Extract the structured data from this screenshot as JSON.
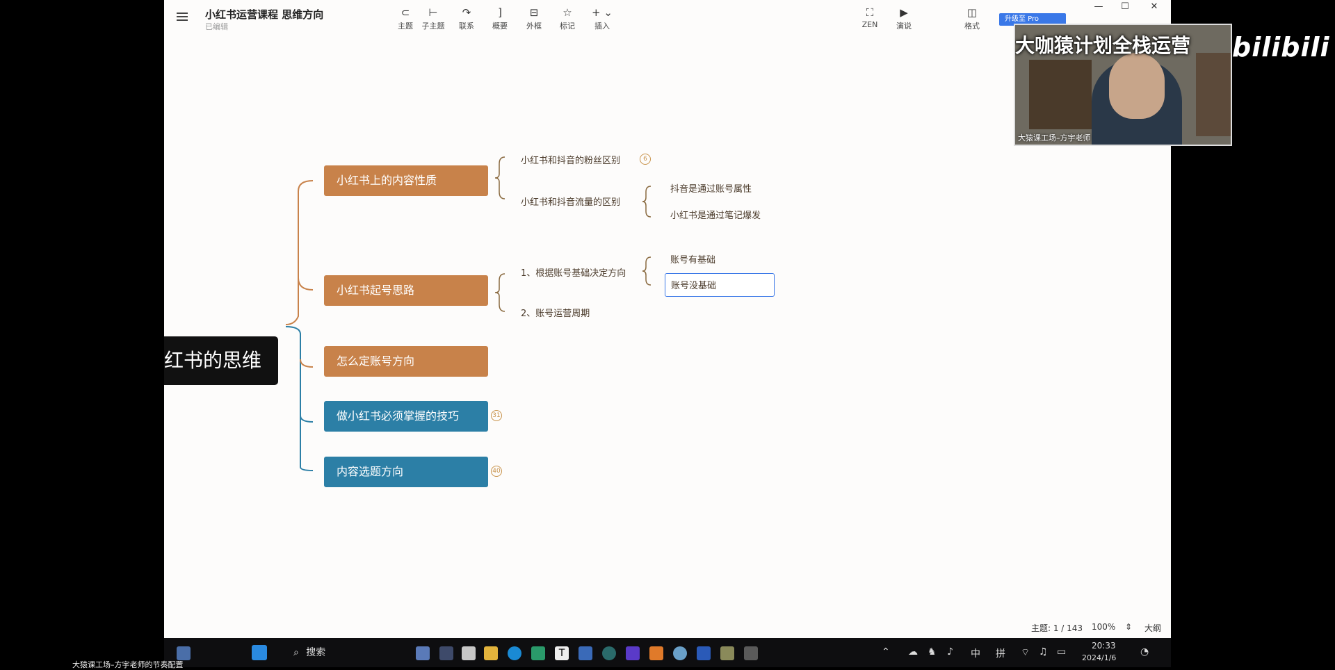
{
  "app": {
    "title": "小红书运营课程 思维方向",
    "status": "已编辑",
    "upgrade_label": "升级至 Pro"
  },
  "toolbar": {
    "tools": [
      {
        "name": "tool-topic",
        "icon": "topic-icon",
        "glyph": "⊂",
        "label": "主题"
      },
      {
        "name": "tool-subtopic",
        "icon": "subtopic-icon",
        "glyph": "⊢",
        "label": "子主题"
      },
      {
        "name": "tool-relationship",
        "icon": "relationship-icon",
        "glyph": "↷",
        "label": "联系"
      },
      {
        "name": "tool-summary",
        "icon": "summary-icon",
        "glyph": "]",
        "label": "概要"
      },
      {
        "name": "tool-boundary",
        "icon": "boundary-icon",
        "glyph": "⊟",
        "label": "外框"
      },
      {
        "name": "tool-marker",
        "icon": "star-icon",
        "glyph": "☆",
        "label": "标记"
      },
      {
        "name": "tool-insert",
        "icon": "plus-icon",
        "glyph": "+ ⌄",
        "label": "插入"
      }
    ],
    "zen_label": "ZEN",
    "present_label": "演说",
    "format_label": "格式"
  },
  "mindmap": {
    "root": "红书的思维",
    "branches": [
      {
        "label": "小红书上的内容性质",
        "color": "orange"
      },
      {
        "label": "小红书起号思路",
        "color": "orange"
      },
      {
        "label": "怎么定账号方向",
        "color": "orange"
      },
      {
        "label": "做小红书必须掌握的技巧",
        "color": "blue",
        "count": "31"
      },
      {
        "label": "内容选题方向",
        "color": "blue",
        "count": "40"
      }
    ],
    "content_nature": {
      "fans_diff": "小红书和抖音的粉丝区别",
      "fans_diff_count": "6",
      "traffic_diff": "小红书和抖音流量的区别",
      "douyin_traffic": "抖音是通过账号属性",
      "xhs_traffic": "小红书是通过笔记爆发"
    },
    "start_ideas": {
      "by_basis": "1、根据账号基础决定方向",
      "has_basis": "账号有基础",
      "no_basis": "账号没基础",
      "cycle": "2、账号运营周期"
    }
  },
  "statusbar": {
    "topic_count": "主题: 1 / 143",
    "zoom": "100%",
    "outline_label": "大纲"
  },
  "webcam": {
    "title": "大咖猿计划全栈运营",
    "caption": "大猿课工场–方宇老师"
  },
  "overlay": {
    "bilibili": "bilibili",
    "bottom_caption": "大猿课工场–方宇老师的节奏配置"
  },
  "taskbar": {
    "search_label": "搜索",
    "ime_zh": "中",
    "ime_pinyin": "拼",
    "time": "20:33",
    "date": "2024/1/6"
  },
  "colors": {
    "orange_branch": "#c8824a",
    "blue_branch": "#2c7fa6",
    "accent": "#3a78e8"
  }
}
